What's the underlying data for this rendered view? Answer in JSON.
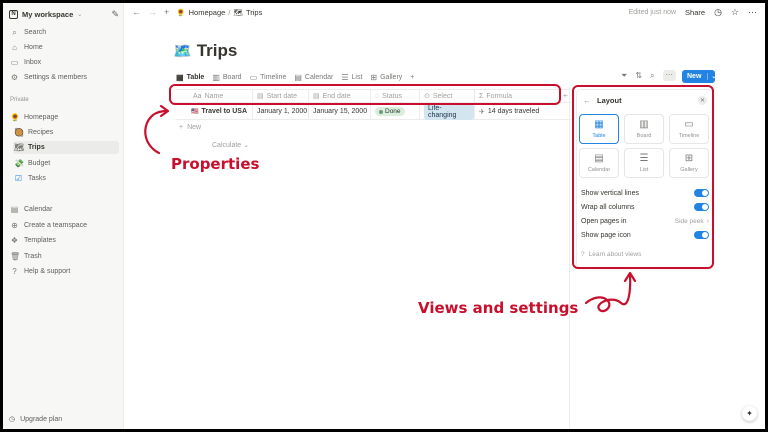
{
  "workspace": {
    "name": "My workspace",
    "logo": "N"
  },
  "sidebar": {
    "top_items": [
      {
        "label": "Search",
        "icon": "search-icon"
      },
      {
        "label": "Home",
        "icon": "home-icon"
      },
      {
        "label": "Inbox",
        "icon": "inbox-icon"
      },
      {
        "label": "Settings & members",
        "icon": "gear-icon"
      }
    ],
    "section_private": "Private",
    "pages": [
      {
        "label": "Homepage",
        "emoji": "🌻"
      },
      {
        "label": "Recipes",
        "emoji": "🥘"
      },
      {
        "label": "Trips",
        "emoji": "🗺"
      },
      {
        "label": "Budget",
        "emoji": "💸"
      },
      {
        "label": "Tasks",
        "emoji": "☑"
      }
    ],
    "bottom_items": [
      {
        "label": "Calendar",
        "icon": "calendar-icon"
      },
      {
        "label": "Create a teamspace",
        "icon": "teamspace-icon"
      },
      {
        "label": "Templates",
        "icon": "templates-icon"
      },
      {
        "label": "Trash",
        "icon": "trash-icon"
      },
      {
        "label": "Help & support",
        "icon": "help-icon"
      }
    ],
    "upgrade": "Upgrade plan"
  },
  "topbar": {
    "breadcrumb": [
      {
        "label": "Homepage",
        "emoji": "🌻"
      },
      {
        "label": "Trips",
        "emoji": "🗺"
      }
    ],
    "edited": "Edited just now",
    "share": "Share"
  },
  "page": {
    "title": "Trips",
    "emoji": "🗺️"
  },
  "views": [
    {
      "label": "Table",
      "icon": "table-icon",
      "glyph": "▦"
    },
    {
      "label": "Board",
      "icon": "board-icon",
      "glyph": "▥"
    },
    {
      "label": "Timeline",
      "icon": "timeline-icon",
      "glyph": "▭"
    },
    {
      "label": "Calendar",
      "icon": "calendar-icon",
      "glyph": "▤"
    },
    {
      "label": "List",
      "icon": "list-icon",
      "glyph": "☰"
    },
    {
      "label": "Gallery",
      "icon": "gallery-icon",
      "glyph": "⊞"
    }
  ],
  "new_button": "New",
  "table": {
    "headers": [
      {
        "label": "Name",
        "glyph": "Aa"
      },
      {
        "label": "Start date",
        "glyph": "▤"
      },
      {
        "label": "End date",
        "glyph": "▤"
      },
      {
        "label": "Status",
        "glyph": "◌"
      },
      {
        "label": "Select",
        "glyph": "⊙"
      },
      {
        "label": "Formula",
        "glyph": "Σ"
      }
    ],
    "rows": [
      {
        "name": "Travel to USA",
        "flag": "🇺🇸",
        "start": "January 1, 2000",
        "end": "January 15, 2000",
        "status": "Done",
        "select": "Life-changing",
        "formula": "14 days traveled"
      }
    ],
    "new_row": "New",
    "calculate": "Calculate"
  },
  "layout_panel": {
    "title": "Layout",
    "cards": [
      {
        "label": "Table",
        "glyph": "▦",
        "selected": true
      },
      {
        "label": "Board",
        "glyph": "▥",
        "selected": false
      },
      {
        "label": "Timeline",
        "glyph": "▭",
        "selected": false
      },
      {
        "label": "Calendar",
        "glyph": "▤",
        "selected": false
      },
      {
        "label": "List",
        "glyph": "☰",
        "selected": false
      },
      {
        "label": "Gallery",
        "glyph": "⊞",
        "selected": false
      }
    ],
    "options": {
      "vertical_lines": "Show vertical lines",
      "wrap_columns": "Wrap all columns",
      "open_pages": "Open pages in",
      "open_pages_value": "Side peek",
      "page_icon": "Show page icon"
    },
    "learn": "Learn about views"
  },
  "annotations": {
    "properties": "Properties",
    "views_settings": "Views and settings",
    "color": "#c8102e"
  }
}
